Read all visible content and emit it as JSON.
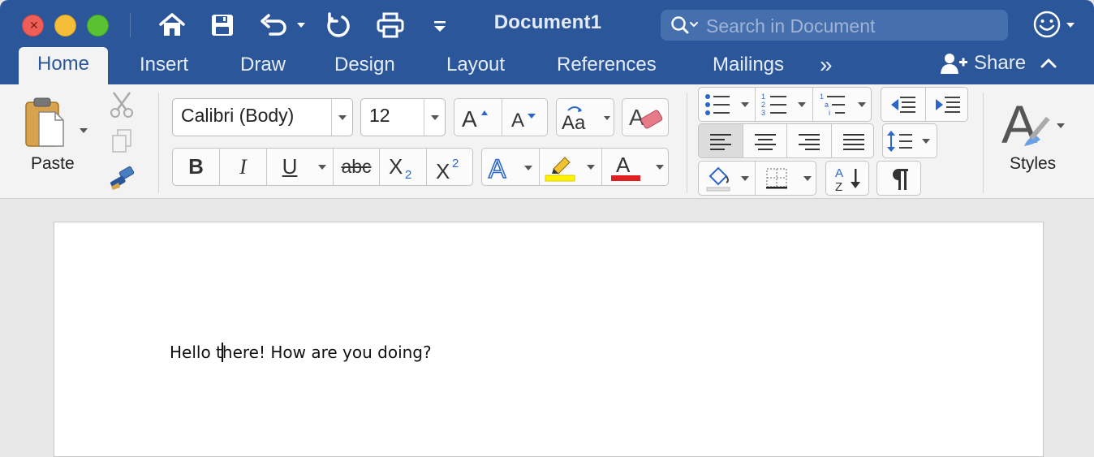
{
  "window": {
    "title": "Document1"
  },
  "search": {
    "placeholder": "Search in Document"
  },
  "tabs": [
    {
      "label": "Home",
      "active": true
    },
    {
      "label": "Insert"
    },
    {
      "label": "Draw"
    },
    {
      "label": "Design"
    },
    {
      "label": "Layout"
    },
    {
      "label": "References"
    },
    {
      "label": "Mailings"
    }
  ],
  "more_tabs_label": "»",
  "share_label": "Share",
  "clipboard": {
    "paste_label": "Paste"
  },
  "font": {
    "name": "Calibri (Body)",
    "size": "12"
  },
  "format_buttons": {
    "bold": "B",
    "italic": "I",
    "underline": "U",
    "strikethrough": "abc"
  },
  "styles_label": "Styles",
  "document": {
    "text_before_cursor": "Hello t",
    "text_after_cursor": "here! How are you doing?"
  },
  "colors": {
    "title_bar": "#2b579a",
    "ribbon": "#f3f3f3",
    "highlight": "#fff200",
    "font_color": "#e02020"
  }
}
